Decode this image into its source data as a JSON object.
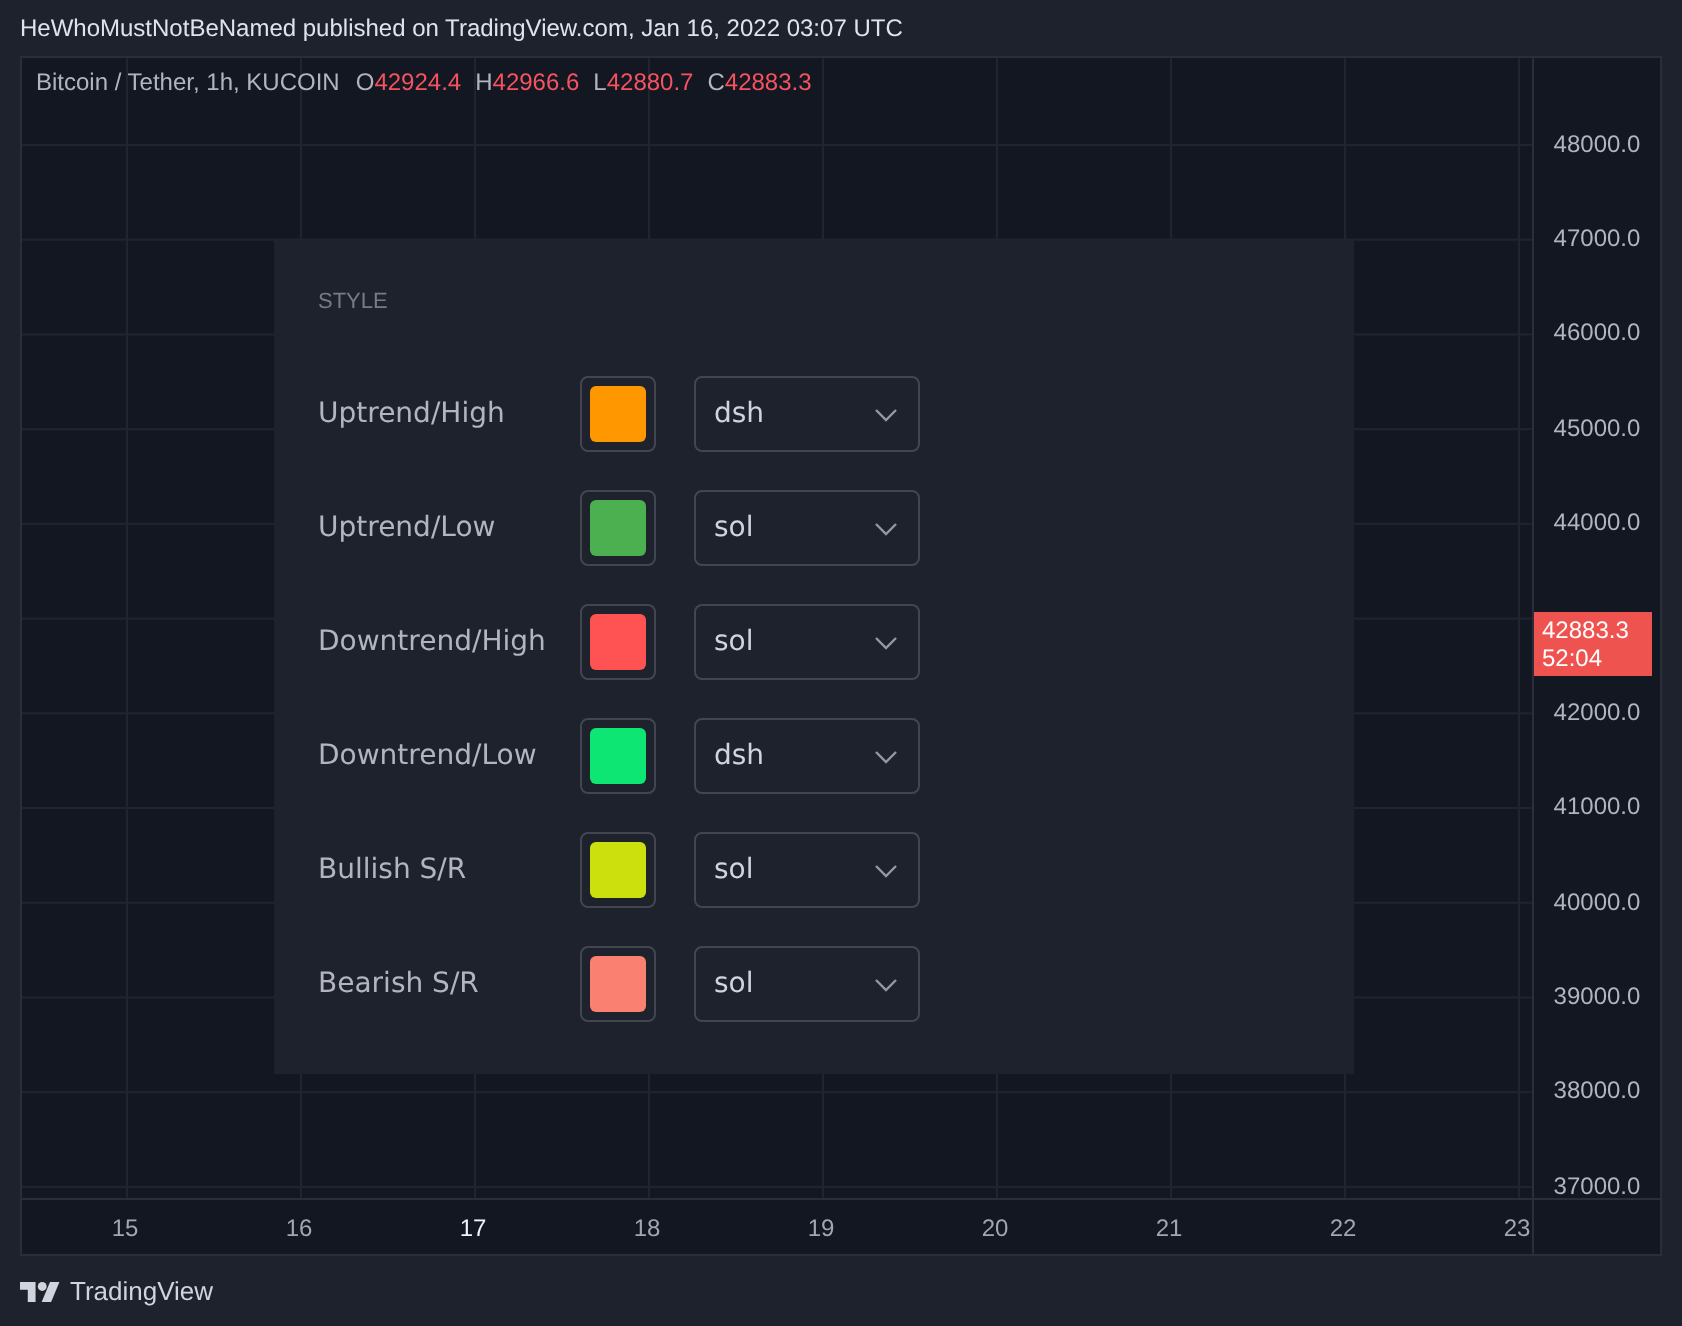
{
  "header": {
    "caption": "HeWhoMustNotBeNamed published on TradingView.com, Jan 16, 2022 03:07 UTC"
  },
  "chart": {
    "legend": {
      "symbol": "Bitcoin / Tether, 1h, KUCOIN",
      "falling": true,
      "values": [
        {
          "label": "O",
          "value": "42924.4"
        },
        {
          "label": "H",
          "value": "42966.6"
        },
        {
          "label": "L",
          "value": "42880.7"
        },
        {
          "label": "C",
          "value": "42883.3"
        }
      ]
    },
    "style_dialog": {
      "section_title": "STYLE",
      "rows": [
        {
          "label": "Uptrend/High",
          "color": "#ff9800",
          "line_style": "dsh"
        },
        {
          "label": "Uptrend/Low",
          "color": "#4caf50",
          "line_style": "sol"
        },
        {
          "label": "Downtrend/High",
          "color": "#ff5252",
          "line_style": "sol"
        },
        {
          "label": "Downtrend/Low",
          "color": "#0ee673",
          "line_style": "dsh"
        },
        {
          "label": "Bullish S/R",
          "color": "#cbe00d",
          "line_style": "sol"
        },
        {
          "label": "Bearish S/R",
          "color": "#fa8072",
          "line_style": "sol"
        }
      ]
    },
    "price_axis": {
      "labels": [
        {
          "kind": "tick",
          "text": "48000.0"
        },
        {
          "kind": "tick",
          "text": "47000.0"
        },
        {
          "kind": "tick",
          "text": "46000.0"
        },
        {
          "kind": "tick",
          "text": "45000.0"
        },
        {
          "kind": "tick",
          "text": "44000.0"
        },
        {
          "kind": "last_price",
          "price": "42883.3",
          "countdown": "52:04"
        },
        {
          "kind": "tick",
          "text": "42000.0"
        },
        {
          "kind": "tick",
          "text": "41000.0"
        },
        {
          "kind": "tick",
          "text": "40000.0"
        },
        {
          "kind": "tick",
          "text": "39000.0"
        },
        {
          "kind": "tick",
          "text": "38000.0"
        },
        {
          "kind": "tick",
          "text": "37000.0"
        }
      ]
    },
    "time_axis": {
      "ticks": [
        {
          "text": "15",
          "emphasized": false
        },
        {
          "text": "16",
          "emphasized": false
        },
        {
          "text": "17",
          "emphasized": true
        },
        {
          "text": "18",
          "emphasized": false
        },
        {
          "text": "19",
          "emphasized": false
        },
        {
          "text": "20",
          "emphasized": false
        },
        {
          "text": "21",
          "emphasized": false
        },
        {
          "text": "22",
          "emphasized": false
        },
        {
          "text": "23",
          "emphasized": false
        }
      ]
    }
  },
  "footer": {
    "brand": "TradingView"
  }
}
